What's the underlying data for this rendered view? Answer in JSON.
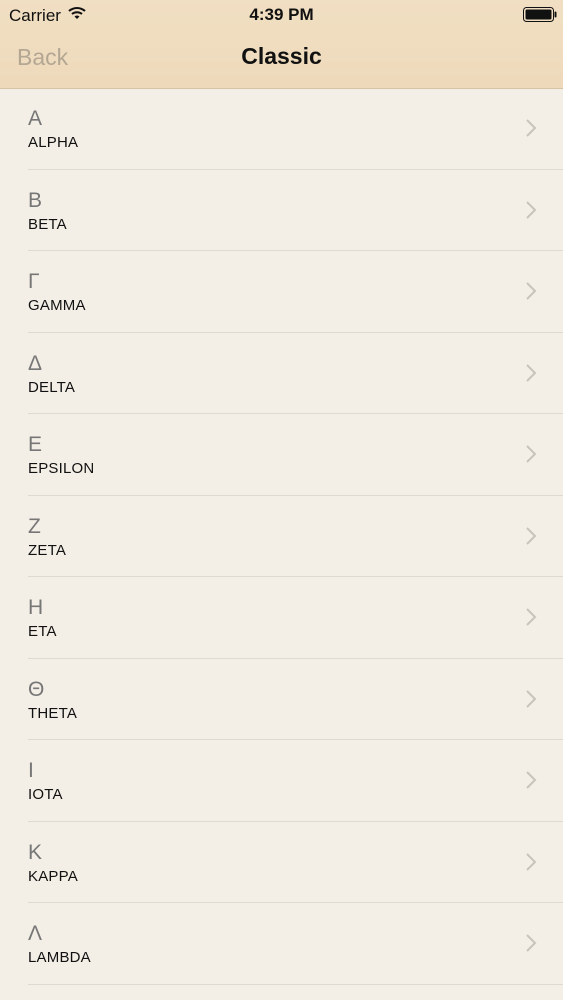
{
  "status_bar": {
    "carrier": "Carrier",
    "time": "4:39 PM"
  },
  "nav": {
    "back_label": "Back",
    "title": "Classic"
  },
  "colors": {
    "nav_background": "#f1dfc3",
    "list_background": "#f4efe6",
    "back_text": "#b3a794",
    "chevron": "#c9c4bb"
  },
  "items": [
    {
      "letter": "Α",
      "name": "ALPHA"
    },
    {
      "letter": "Β",
      "name": "BETA"
    },
    {
      "letter": "Γ",
      "name": "GAMMA"
    },
    {
      "letter": "Δ",
      "name": "DELTA"
    },
    {
      "letter": "Ε",
      "name": "EPSILON"
    },
    {
      "letter": "Ζ",
      "name": "ZETA"
    },
    {
      "letter": "Η",
      "name": "ETA"
    },
    {
      "letter": "Θ",
      "name": "THETA"
    },
    {
      "letter": "Ι",
      "name": "IOTA"
    },
    {
      "letter": "Κ",
      "name": "KAPPA"
    },
    {
      "letter": "Λ",
      "name": "LAMBDA"
    }
  ]
}
